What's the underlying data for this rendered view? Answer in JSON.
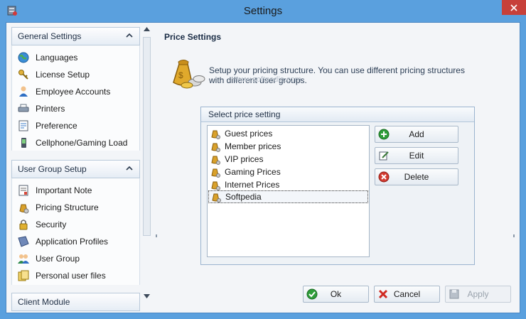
{
  "window": {
    "title": "Settings"
  },
  "nav": {
    "groups": [
      {
        "label": "General Settings",
        "items": [
          {
            "label": "Languages",
            "icon": "globe-icon"
          },
          {
            "label": "License Setup",
            "icon": "keys-icon"
          },
          {
            "label": "Employee Accounts",
            "icon": "user-icon"
          },
          {
            "label": "Printers",
            "icon": "printer-icon"
          },
          {
            "label": "Preference",
            "icon": "preference-icon"
          },
          {
            "label": "Cellphone/Gaming Load",
            "icon": "cellphone-icon"
          }
        ]
      },
      {
        "label": "User Group Setup",
        "items": [
          {
            "label": "Important Note",
            "icon": "note-icon"
          },
          {
            "label": "Pricing Structure",
            "icon": "money-bag-icon"
          },
          {
            "label": "Security",
            "icon": "lock-icon"
          },
          {
            "label": "Application Profiles",
            "icon": "application-icon"
          },
          {
            "label": "User Group",
            "icon": "user-group-icon"
          },
          {
            "label": "Personal user files",
            "icon": "files-icon"
          }
        ]
      },
      {
        "label": "Client Module",
        "items": []
      }
    ]
  },
  "main": {
    "heading": "Price Settings",
    "description": "Setup your pricing structure. You can use different pricing structures with different user groups.",
    "watermark": "www.softpedia.com",
    "price_box": {
      "title": "Select price setting",
      "items": [
        "Guest prices",
        "Member prices",
        "VIP prices",
        "Gaming Prices",
        "Internet Prices",
        "Softpedia"
      ],
      "selected_index": 5
    },
    "actions": {
      "add": "Add",
      "edit": "Edit",
      "delete": "Delete"
    }
  },
  "footer": {
    "ok": "Ok",
    "cancel": "Cancel",
    "apply": "Apply"
  },
  "colors": {
    "titlebar": "#5aa0de",
    "close": "#c7403a",
    "panel": "#f3f5f8"
  }
}
